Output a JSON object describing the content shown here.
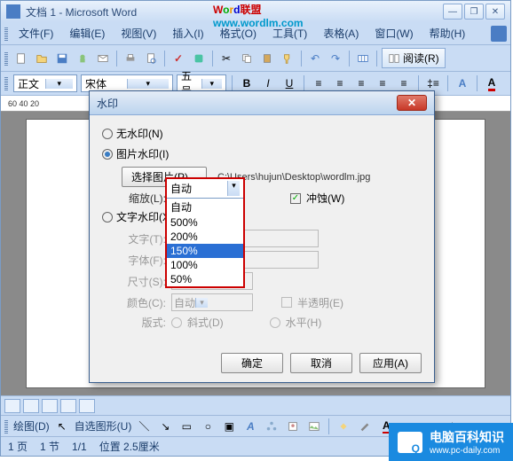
{
  "window": {
    "title": "文档 1 - Microsoft Word"
  },
  "logo": {
    "w": "W",
    "o": "o",
    "r": "r",
    "d": "d",
    "cn": "联盟",
    "url": "www.wordlm.com"
  },
  "menu": {
    "file": "文件(F)",
    "edit": "编辑(E)",
    "view": "视图(V)",
    "insert": "插入(I)",
    "format": "格式(O)",
    "tools": "工具(T)",
    "table": "表格(A)",
    "window": "窗口(W)",
    "help": "帮助(H)"
  },
  "toolbar": {
    "read": "阅读(R)"
  },
  "format": {
    "style": "正文",
    "font": "宋体",
    "size": "五号"
  },
  "ruler": "60     40     20",
  "dialog": {
    "title": "水印",
    "none": "无水印(N)",
    "picture": "图片水印(I)",
    "select_picture": "选择图片(P)...",
    "path": "C:\\Users\\hujun\\Desktop\\wordlm.jpg",
    "scale": "缩放(L):",
    "washout": "冲蚀(W)",
    "text_wm": "文字水印(X)",
    "text": "文字(T):",
    "font_lbl": "字体(F):",
    "size": "尺寸(S):",
    "color": "颜色(C):",
    "color_auto": "自动",
    "semi": "半透明(E)",
    "layout": "版式:",
    "diagonal": "斜式(D)",
    "horizontal": "水平(H)",
    "ok": "确定",
    "cancel": "取消",
    "apply": "应用(A)"
  },
  "dropdown": {
    "selected": "自动",
    "items": [
      "自动",
      "500%",
      "200%",
      "150%",
      "100%",
      "50%"
    ],
    "highlighted": "150%"
  },
  "drawbar": {
    "draw": "绘图(D)",
    "autoshapes": "自选图形(U)"
  },
  "status": {
    "page": "1 页",
    "sec": "1 节",
    "pages": "1/1",
    "pos": "位置 2.5厘米"
  },
  "site": {
    "name": "电脑百科知识",
    "url": "www.pc-daily.com"
  }
}
